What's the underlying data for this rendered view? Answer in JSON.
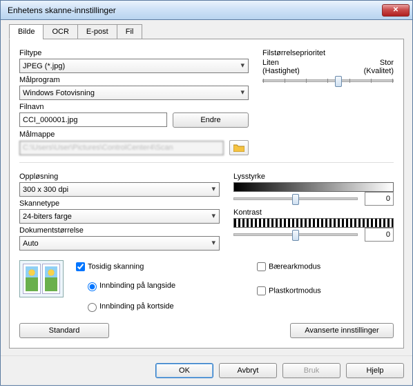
{
  "window": {
    "title": "Enhetens skanne-innstillinger"
  },
  "tabs": {
    "image": "Bilde",
    "ocr": "OCR",
    "email": "E-post",
    "file": "Fil"
  },
  "labels": {
    "filetype": "Filtype",
    "targetapp": "Målprogram",
    "filename": "Filnavn",
    "change": "Endre",
    "destfolder": "Målmappe",
    "priority": "Filstørrelseprioritet",
    "small": "Liten",
    "large": "Stor",
    "speed": "(Hastighet)",
    "quality": "(Kvalitet)",
    "resolution": "Oppløsning",
    "scantype": "Skannetype",
    "docsize": "Dokumentstørrelse",
    "brightness": "Lysstyrke",
    "contrast": "Kontrast",
    "duplex": "Tosidig skanning",
    "bind_long": "Innbinding på langside",
    "bind_short": "Innbinding på kortside",
    "carrier": "Bærearkmodus",
    "plastic": "Plastkortmodus",
    "default": "Standard",
    "advanced": "Avanserte innstillinger",
    "ok": "OK",
    "cancel": "Avbryt",
    "apply": "Bruk",
    "help": "Hjelp"
  },
  "values": {
    "filetype": "JPEG (*.jpg)",
    "targetapp": "Windows Fotovisning",
    "filename": "CCI_000001.jpg",
    "destfolder": "C:\\Users\\User\\Pictures\\ControlCenter4\\Scan",
    "resolution": "300 x 300 dpi",
    "scantype": "24-biters farge",
    "docsize": "Auto",
    "brightness": "0",
    "contrast": "0"
  }
}
